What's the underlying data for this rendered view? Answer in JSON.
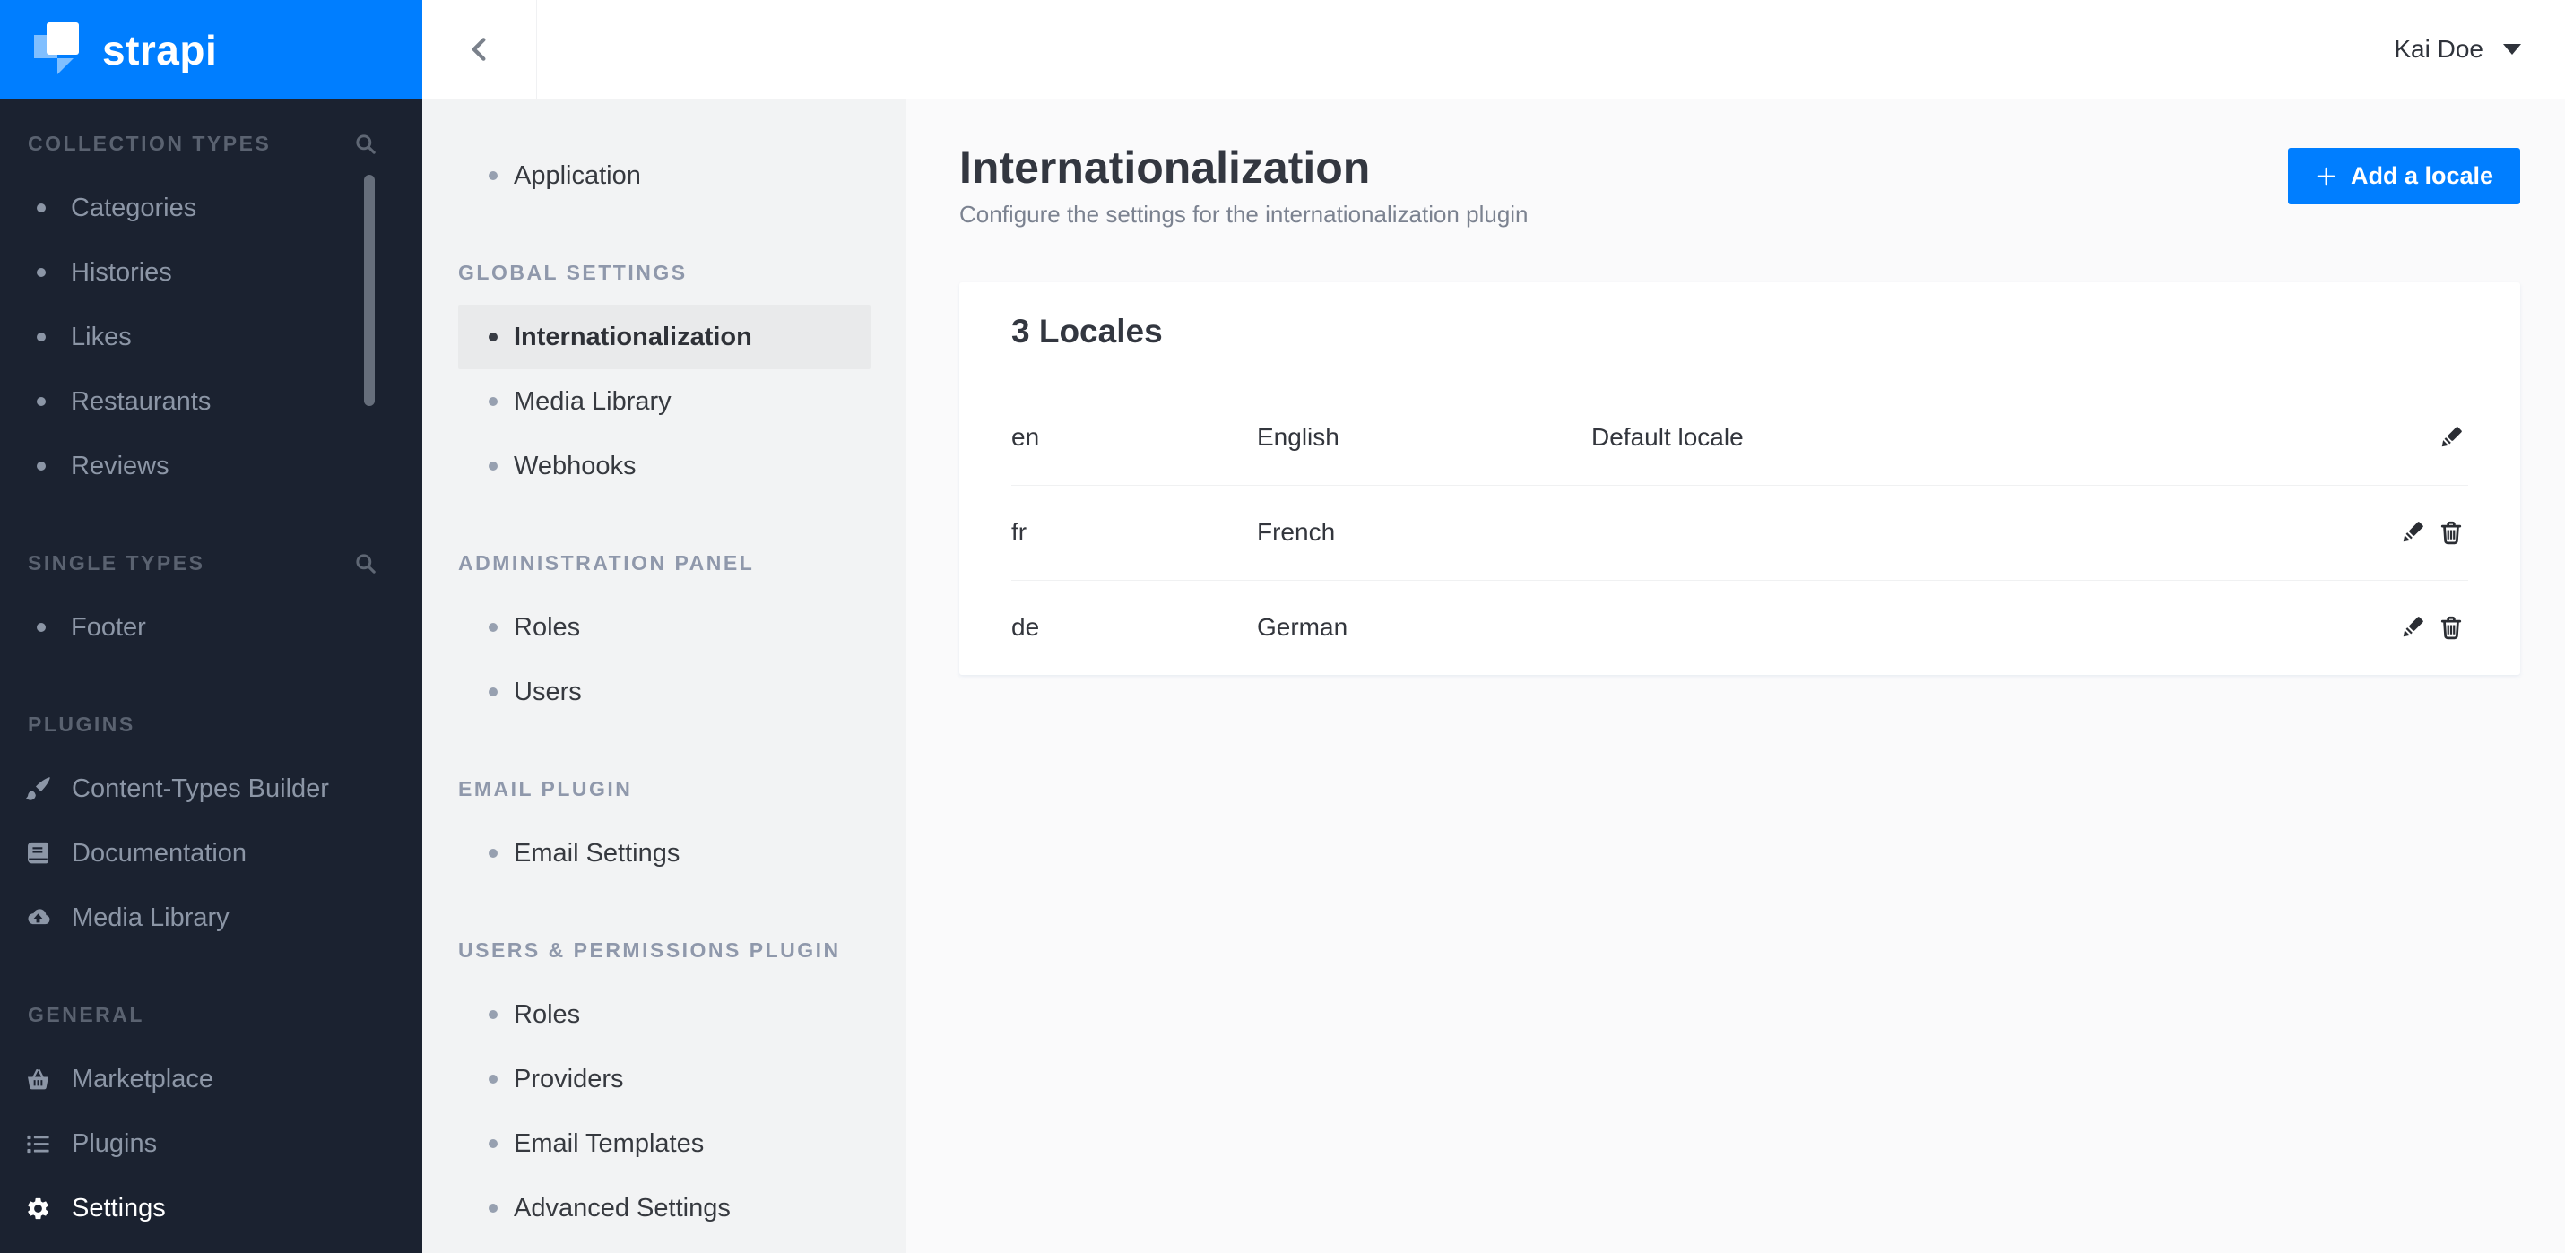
{
  "brand": {
    "logo_text": "strapi"
  },
  "topbar": {
    "user_name": "Kai Doe",
    "back_icon": "chevron-left-icon",
    "user_caret_icon": "caret-down-icon"
  },
  "sidebar": {
    "sections": [
      {
        "label": "COLLECTION TYPES",
        "search_icon": "search-icon",
        "items": [
          {
            "label": "Categories",
            "icon": "bullet-icon"
          },
          {
            "label": "Histories",
            "icon": "bullet-icon"
          },
          {
            "label": "Likes",
            "icon": "bullet-icon"
          },
          {
            "label": "Restaurants",
            "icon": "bullet-icon"
          },
          {
            "label": "Reviews",
            "icon": "bullet-icon"
          }
        ]
      },
      {
        "label": "SINGLE TYPES",
        "search_icon": "search-icon",
        "items": [
          {
            "label": "Footer",
            "icon": "bullet-icon"
          }
        ]
      },
      {
        "label": "PLUGINS",
        "items": [
          {
            "label": "Content-Types Builder",
            "icon": "paintbrush-icon"
          },
          {
            "label": "Documentation",
            "icon": "book-icon"
          },
          {
            "label": "Media Library",
            "icon": "cloud-upload-icon"
          }
        ]
      },
      {
        "label": "GENERAL",
        "items": [
          {
            "label": "Marketplace",
            "icon": "basket-icon"
          },
          {
            "label": "Plugins",
            "icon": "list-icon"
          },
          {
            "label": "Settings",
            "icon": "gear-icon",
            "active": true
          }
        ]
      }
    ]
  },
  "settings_nav": {
    "groups": [
      {
        "items": [
          {
            "label": "Application"
          }
        ]
      },
      {
        "header": "GLOBAL SETTINGS",
        "items": [
          {
            "label": "Internationalization",
            "selected": true
          },
          {
            "label": "Media Library"
          },
          {
            "label": "Webhooks"
          }
        ]
      },
      {
        "header": "ADMINISTRATION PANEL",
        "items": [
          {
            "label": "Roles"
          },
          {
            "label": "Users"
          }
        ]
      },
      {
        "header": "EMAIL PLUGIN",
        "items": [
          {
            "label": "Email Settings"
          }
        ]
      },
      {
        "header": "USERS & PERMISSIONS PLUGIN",
        "items": [
          {
            "label": "Roles"
          },
          {
            "label": "Providers"
          },
          {
            "label": "Email Templates"
          },
          {
            "label": "Advanced Settings"
          }
        ]
      }
    ]
  },
  "main": {
    "title": "Internationalization",
    "subtitle": "Configure the settings for the internationalization plugin",
    "add_button": {
      "label": "Add a locale",
      "icon": "plus-icon"
    },
    "locales_table": {
      "title": "3 Locales",
      "rows": [
        {
          "code": "en",
          "name": "English",
          "note": "Default locale",
          "actions": [
            "edit"
          ]
        },
        {
          "code": "fr",
          "name": "French",
          "note": "",
          "actions": [
            "edit",
            "delete"
          ]
        },
        {
          "code": "de",
          "name": "German",
          "note": "",
          "actions": [
            "edit",
            "delete"
          ]
        }
      ]
    }
  },
  "colors": {
    "accent_blue": "#007EFF",
    "sidebar_bg": "#1B2230",
    "subnav_bg": "#F2F3F4",
    "content_bg": "#FAFAFB",
    "selected_item_bg": "#E9EAEB"
  }
}
